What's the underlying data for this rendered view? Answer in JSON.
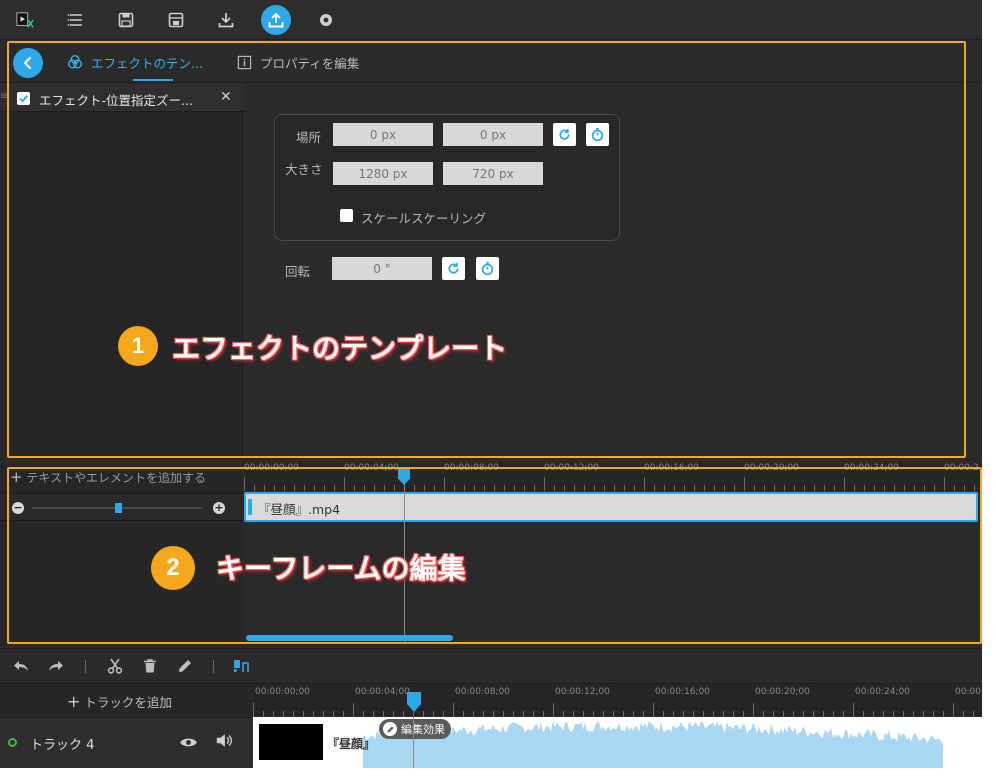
{
  "colors": {
    "accent": "#2fa8ea",
    "annotation": "#f4a81d",
    "annotation_text_outline": "#ff5a5a",
    "background": "#2b2b2b"
  },
  "toolbar": {
    "icons": [
      "app-logo-icon",
      "list-icon",
      "save-icon",
      "save-as-icon",
      "download-icon",
      "export-icon",
      "settings-icon"
    ]
  },
  "header": {
    "tab_effect": "エフェクトのテン...",
    "tab_properties": "プロパティを編集"
  },
  "effect_panel": {
    "item_label": "エフェクト-位置指定ズー...",
    "item_checked": true
  },
  "properties": {
    "position_label": "場所",
    "position_x": "0 px",
    "position_y": "0 px",
    "size_label": "大きさ",
    "size_w": "1280 px",
    "size_h": "720 px",
    "scale_label": "スケールスケーリング",
    "scale_checked": false,
    "rotation_label": "回転",
    "rotation_value": "0 °"
  },
  "annotations": {
    "one_number": "1",
    "one_text": "エフェクトのテンプレート",
    "two_number": "2",
    "two_text": "キーフレームの編集"
  },
  "keyframe_editor": {
    "add_label": "テキストやエレメントを追加する",
    "ticks": [
      "00:00:00;00",
      "00:00:04;00",
      "00:00:08;00",
      "00:00:12;00",
      "00:00:16;00",
      "00:00:20;00",
      "00:00:24;00",
      "00:00:2"
    ],
    "clip_name": "『昼顔』.mp4",
    "zoom_minus": "−",
    "zoom_plus": "+"
  },
  "bottom": {
    "add_track": "トラックを追加",
    "ticks": [
      "00:00:00;00",
      "00:00:04;00",
      "00:00:08;00",
      "00:00:12;00",
      "00:00:16;00",
      "00:00:20;00",
      "00:00:24;00",
      "00:00"
    ],
    "track_name": "トラック 4",
    "lane_clip_name": "『昼顔』",
    "edit_badge": "編集効果"
  }
}
